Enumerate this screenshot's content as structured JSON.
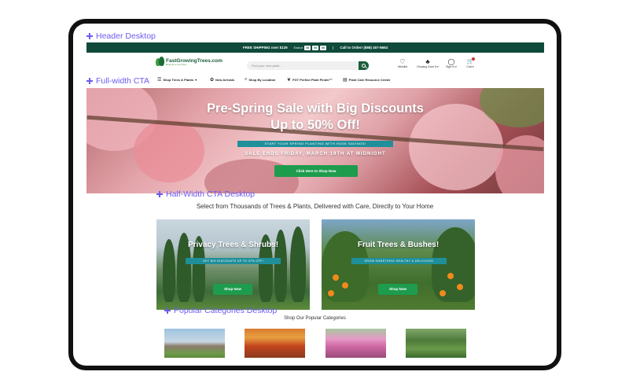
{
  "labels": {
    "header_desktop": "Header Desktop",
    "full_width_cta": "Full-width CTA",
    "half_width_cta_desktop": "Half-Width CTA Desktop",
    "popular_categories_desktop": "Popular Categories Desktop"
  },
  "promo": {
    "free_shipping": "FREE SHIPPING over $129",
    "ends_in": "Ends in",
    "timer": [
      "00",
      "00",
      "00"
    ],
    "call": "Call to Order! (888) 407-8663"
  },
  "header": {
    "brand": "FastGrowingTrees.com",
    "brand_tagline": "Bring Life to Your Home",
    "search_placeholder": "Find your next plant...",
    "icons": [
      {
        "name": "heart-icon",
        "label": "Wishlist",
        "glyph": "♡"
      },
      {
        "name": "tree-icon",
        "label": "Growing Zone 8 ▾",
        "glyph": "♣"
      },
      {
        "name": "user-icon",
        "label": "Sign In ▾",
        "glyph": "◯"
      },
      {
        "name": "cart-icon",
        "label": "Cart ▾",
        "glyph": "🛒"
      }
    ]
  },
  "nav": {
    "items": [
      {
        "label": "Shop Trees & Plants",
        "glyph": "☰"
      },
      {
        "label": "New Arrivals",
        "glyph": "✿"
      },
      {
        "label": "Shop By Location",
        "glyph": "⌕"
      },
      {
        "label": "FGT Perfect Plant Finder™",
        "glyph": "❦"
      },
      {
        "label": "Plant Care Resource Center",
        "glyph": "▤"
      }
    ]
  },
  "hero": {
    "title_line1": "Pre-Spring Sale with Big Discounts",
    "title_line2": "Up to 50% Off!",
    "ribbon": "START YOUR SPRING PLANTING WITH HUGE SAVINGS!",
    "ends": "SALE ENDS FRIDAY, MARCH 19TH AT MIDNIGHT",
    "cta": "Click Here to Shop Now"
  },
  "tagline": "Select from Thousands of Trees & Plants, Delivered with Care, Directly to Your Home",
  "cards": [
    {
      "title": "Privacy Trees & Shrubs!",
      "ribbon": "GET BIG DISCOUNTS UP TO 37% OFF!",
      "cta": "Shop Now"
    },
    {
      "title": "Fruit Trees & Bushes!",
      "ribbon": "GROW SOMETHING HEALTHY & DELICIOUS!",
      "cta": "Shop Now"
    }
  ],
  "categories": {
    "title": "Shop Our Popular Categories"
  }
}
